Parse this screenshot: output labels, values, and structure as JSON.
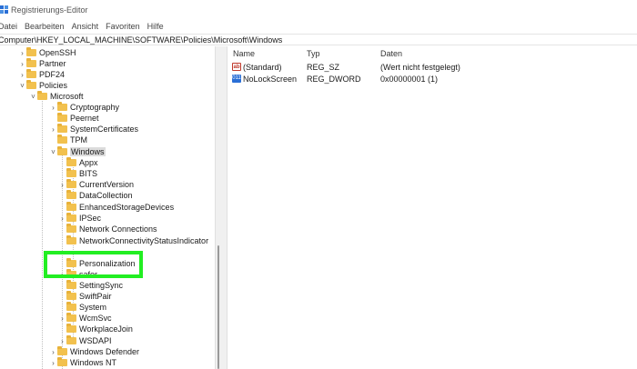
{
  "window": {
    "title": "Registrierungs-Editor"
  },
  "menu": [
    "Datei",
    "Bearbeiten",
    "Ansicht",
    "Favoriten",
    "Hilfe"
  ],
  "address": "Computer\\HKEY_LOCAL_MACHINE\\SOFTWARE\\Policies\\Microsoft\\Windows",
  "tree": [
    {
      "label": "OpenSSH",
      "expander": "collapsed"
    },
    {
      "label": "Partner",
      "expander": "collapsed"
    },
    {
      "label": "PDF24",
      "expander": "collapsed"
    },
    {
      "label": "Policies",
      "expander": "expanded"
    },
    {
      "label": "Microsoft",
      "expander": "expanded"
    },
    {
      "label": "Cryptography",
      "expander": "collapsed"
    },
    {
      "label": "Peernet",
      "expander": "none"
    },
    {
      "label": "SystemCertificates",
      "expander": "collapsed"
    },
    {
      "label": "TPM",
      "expander": "none"
    },
    {
      "label": "Windows",
      "expander": "expanded",
      "selected": true
    },
    {
      "label": "Appx",
      "expander": "none"
    },
    {
      "label": "BITS",
      "expander": "none"
    },
    {
      "label": "CurrentVersion",
      "expander": "collapsed"
    },
    {
      "label": "DataCollection",
      "expander": "none"
    },
    {
      "label": "EnhancedStorageDevices",
      "expander": "none"
    },
    {
      "label": "IPSec",
      "expander": "collapsed"
    },
    {
      "label": "Network Connections",
      "expander": "none"
    },
    {
      "label": "NetworkConnectivityStatusIndicator",
      "expander": "none"
    },
    {
      "label": "Personalization",
      "expander": "none"
    },
    {
      "label": "safer",
      "expander": "collapsed"
    },
    {
      "label": "SettingSync",
      "expander": "none"
    },
    {
      "label": "SwiftPair",
      "expander": "none"
    },
    {
      "label": "System",
      "expander": "none"
    },
    {
      "label": "WcmSvc",
      "expander": "collapsed"
    },
    {
      "label": "WorkplaceJoin",
      "expander": "none"
    },
    {
      "label": "WSDAPI",
      "expander": "collapsed"
    },
    {
      "label": "Windows Defender",
      "expander": "collapsed"
    },
    {
      "label": "Windows NT",
      "expander": "collapsed"
    }
  ],
  "list": {
    "headers": {
      "name": "Name",
      "type": "Typ",
      "data": "Daten"
    },
    "rows": [
      {
        "icon": "string-value-icon",
        "icon_text": "ab",
        "name": "(Standard)",
        "type": "REG_SZ",
        "data": "(Wert nicht festgelegt)"
      },
      {
        "icon": "dword-value-icon",
        "icon_text": "011",
        "name": "NoLockScreen",
        "type": "REG_DWORD",
        "data": "0x00000001 (1)"
      }
    ]
  },
  "colors": {
    "highlight": "#22ee22",
    "folder": "#f2c14e",
    "selection": "#dcdcdc"
  }
}
